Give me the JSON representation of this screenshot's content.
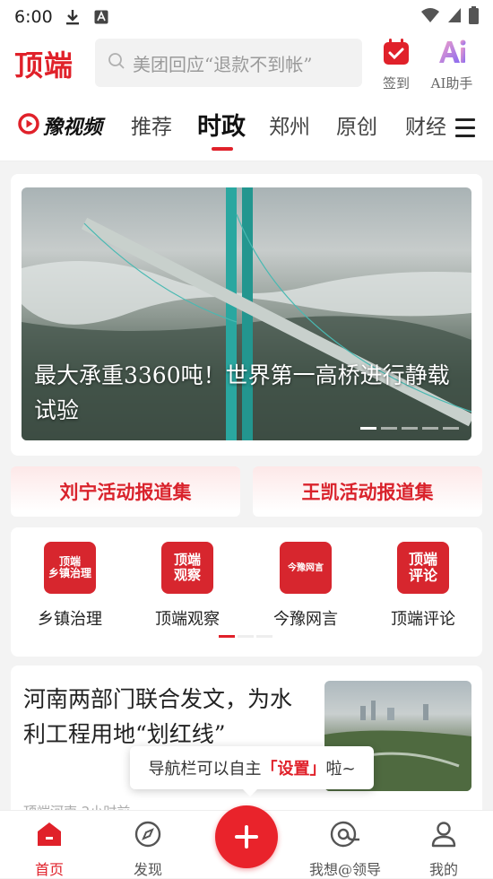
{
  "status": {
    "time": "6:00"
  },
  "header": {
    "logo": "顶端",
    "search_placeholder": "美团回应“退款不到帐”",
    "checkin_label": "签到",
    "ai_label": "AI助手"
  },
  "tabs": {
    "brand": "豫视频",
    "items": [
      "推荐",
      "时政",
      "郑州",
      "原创",
      "财经"
    ],
    "active": "时政"
  },
  "hero": {
    "title": "最大承重3360吨！世界第一高桥进行静载试验",
    "slides": 5,
    "active_slide": 1
  },
  "reports": [
    "刘宁活动报道集",
    "王凯活动报道集"
  ],
  "categories": [
    {
      "icon_text": "顶端\n乡镇治理",
      "label": "乡镇治理"
    },
    {
      "icon_text": "顶端\n观察",
      "label": "顶端观察"
    },
    {
      "icon_text": "今豫网言",
      "label": "今豫网言"
    },
    {
      "icon_text": "顶端\n评论",
      "label": "顶端评论"
    }
  ],
  "news": {
    "title": "河南两部门联合发文，为水利工程用地“划红线”",
    "meta": "顶端河南 2小时前"
  },
  "toast": {
    "pre": "导航栏可以自主",
    "highlight": "「设置」",
    "post": "啦~"
  },
  "bottom_nav": [
    "首页",
    "发现",
    "我想@领导",
    "我的"
  ],
  "colors": {
    "accent": "#e0212a"
  }
}
